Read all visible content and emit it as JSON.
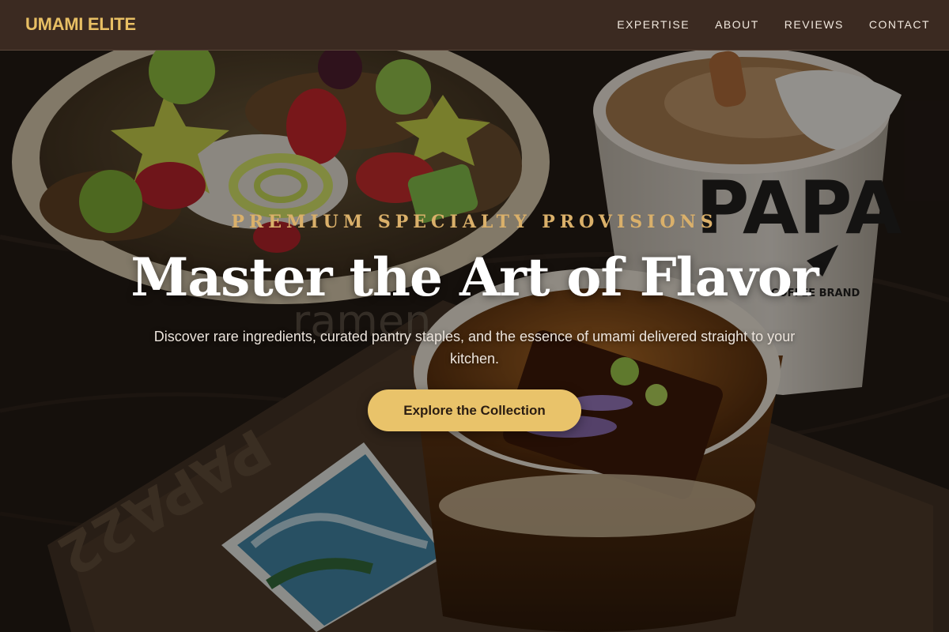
{
  "nav": {
    "brand": "UMAMI ELITE",
    "links": [
      {
        "label": "EXPERTISE"
      },
      {
        "label": "ABOUT"
      },
      {
        "label": "REVIEWS"
      },
      {
        "label": "CONTACT"
      }
    ]
  },
  "hero": {
    "eyebrow": "PREMIUM SPECIALTY PROVISIONS",
    "headline": "Master the Art of Flavor",
    "subtext": "Discover rare ingredients, curated pantry staples, and the essence of umami delivered straight to your kitchen.",
    "cta_label": "Explore the Collection"
  },
  "background": {
    "cup_print": "PAPA",
    "cup_small_print": "COFFEE BRAND",
    "tray_print": "PAPA22",
    "bowl_print": "ramen"
  },
  "colors": {
    "accent": "#e9c36a",
    "nav_bg": "#3b2a21",
    "brand": "#e8bf64",
    "eyebrow": "#dab06a"
  }
}
